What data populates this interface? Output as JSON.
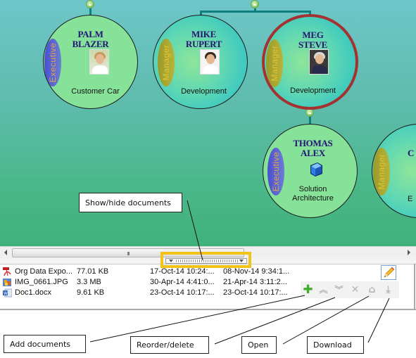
{
  "org_chart": {
    "nodes": [
      {
        "id": "palm",
        "name_line1": "PALM",
        "name_line2": "BLAZER",
        "role": "Executive",
        "department": "Customer Car",
        "selected": false
      },
      {
        "id": "mike",
        "name_line1": "MIKE",
        "name_line2": "RUPERT",
        "role": "Manager",
        "department": "Development",
        "selected": false
      },
      {
        "id": "meg",
        "name_line1": "MEG",
        "name_line2": "STEVE",
        "role": "Manager",
        "department": "Development",
        "selected": true
      },
      {
        "id": "thomas",
        "name_line1": "THOMAS",
        "name_line2": "ALEX",
        "role": "Executive",
        "department_line1": "Solution",
        "department_line2": "Architecture",
        "selected": false
      },
      {
        "id": "partial",
        "name_line1": "C",
        "role": "Manager",
        "department": "E",
        "selected": false
      }
    ],
    "colors": {
      "selected_border": "#a33231",
      "connector": "#0e7f7d",
      "executive_pill": "#4a4fd0",
      "manager_pill": "#b8b437"
    }
  },
  "scrollbar": {
    "grip": "III"
  },
  "documents": {
    "rows": [
      {
        "icon": "pdf-icon",
        "name": "Org Data Expo...",
        "size": "77.01 KB",
        "created": "17-Oct-14 10:24:...",
        "modified": "08-Nov-14 9:34:1..."
      },
      {
        "icon": "image-icon",
        "name": "IMG_0661.JPG",
        "size": "3.3 MB",
        "created": "30-Apr-14 4:41:0...",
        "modified": "21-Apr-14 3:11:2..."
      },
      {
        "icon": "word-icon",
        "name": "Doc1.docx",
        "size": "9.61 KB",
        "created": "23-Oct-14 10:17:...",
        "modified": "23-Oct-14 10:17:..."
      }
    ],
    "toolbar": {
      "add": "✚",
      "move_up": "︽",
      "move_down": "︾",
      "delete": "✕",
      "open": "⌂",
      "download": "⤓"
    }
  },
  "callouts": {
    "show_hide": "Show/hide documents",
    "add": "Add documents",
    "reorder_delete": "Reorder/delete",
    "open": "Open",
    "download": "Download"
  },
  "highlight_color": "#f5c218"
}
